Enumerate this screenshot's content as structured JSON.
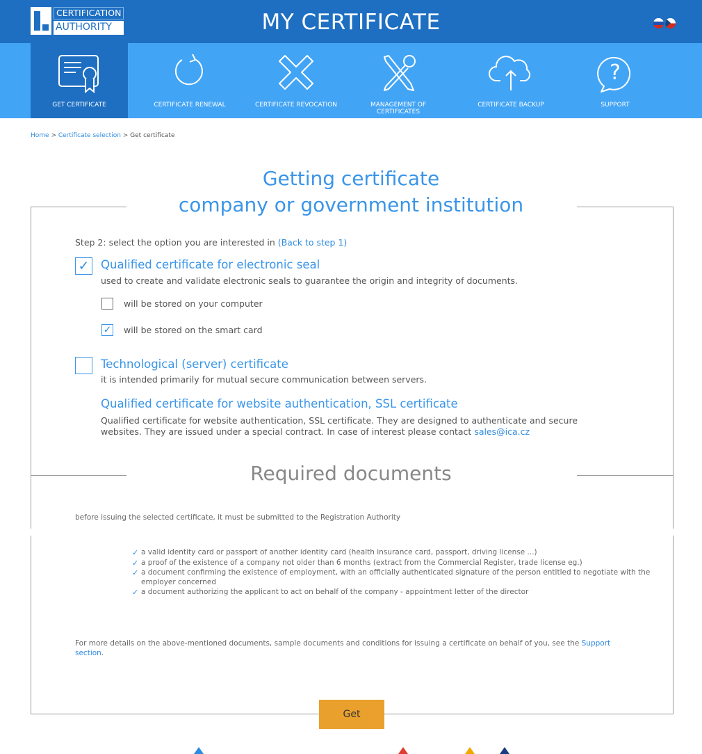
{
  "header": {
    "logo_line1": "CERTIFICATION",
    "logo_line2": "AUTHORITY",
    "title": "MY CERTIFICATE",
    "languages": [
      "sk-flag-icon",
      "cz-flag-icon"
    ]
  },
  "nav": {
    "items": [
      {
        "label": "GET CERTIFICATE",
        "icon": "certificate-icon",
        "active": true
      },
      {
        "label": "CERTIFICATE RENEWAL",
        "icon": "renewal-icon"
      },
      {
        "label": "CERTIFICATE REVOCATION",
        "icon": "revocation-icon"
      },
      {
        "label": "MANAGEMENT OF CERTIFICATES",
        "icon": "tools-icon"
      },
      {
        "label": "CERTIFICATE BACKUP",
        "icon": "cloud-upload-icon"
      },
      {
        "label": "SUPPORT",
        "icon": "question-icon"
      }
    ]
  },
  "breadcrumb": {
    "home": "Home",
    "sep1": " > ",
    "selection": "Certificate selection",
    "sep2": " > ",
    "current": "Get certificate"
  },
  "page": {
    "title_line1": "Getting certificate",
    "title_line2": "company or government institution",
    "step_text": "Step 2: select the option you are interested in ",
    "back_link": "(Back to step 1)"
  },
  "options": {
    "seal": {
      "checked": true,
      "title": "Qualified certificate for electronic seal",
      "desc": "used to create and validate electronic seals to guarantee the origin and integrity of documents.",
      "storage_computer": {
        "label": "will be stored on your computer",
        "checked": false
      },
      "storage_card": {
        "label": "will be stored on the smart card",
        "checked": true
      }
    },
    "server": {
      "checked": false,
      "title": "Technological (server) certificate",
      "desc": "it is intended primarily for mutual secure communication between servers."
    },
    "ssl": {
      "title": "Qualified certificate for website authentication, SSL certificate",
      "desc": "Qualified certificate for website authentication, SSL certificate. They are designed to authenticate and secure websites. They are issued under a special contract. In case of interest please contact ",
      "email": "sales@ica.cz"
    }
  },
  "required": {
    "title": "Required documents",
    "intro": "before issuing the selected certificate, it must be submitted to the Registration Authority",
    "items": [
      "a valid identity card or passport of another identity card (health insurance card, passport, driving license ...)",
      "a proof of the existence of a company not older than 6 months (extract from the Commercial Register, trade license eg.)",
      "a document confirming the existence of employment, with an officially authenticated signature of the person entitled to negotiate with the employer concerned",
      "a document authorizing the applicant to act on behalf of the company - appointment letter of the director"
    ],
    "more_text": "For more details on the above-mentioned documents, sample documents and conditions for issuing a certificate on behalf of you, see the ",
    "support_link": "Support section",
    "more_end": "."
  },
  "actions": {
    "get_label": "Get"
  },
  "colors": {
    "header_blue": "#1e6fc2",
    "nav_blue": "#42a4f5",
    "accent_blue": "#3a95e8",
    "button_orange": "#e9a02c"
  }
}
